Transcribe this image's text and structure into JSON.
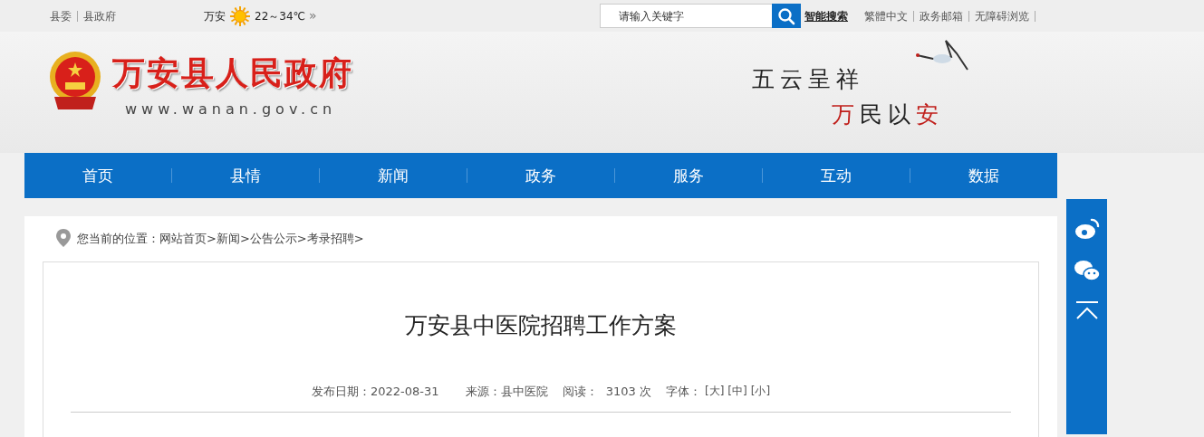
{
  "top_bar": {
    "links": [
      "县委",
      "县政府"
    ],
    "weather": {
      "city": "万安",
      "temperature": "22～34℃",
      "more": "»"
    },
    "search": {
      "placeholder": "请输入关键字"
    },
    "smart_search": "智能搜索",
    "right_links": [
      "繁體中文",
      "政务邮箱",
      "无障碍浏览"
    ]
  },
  "header": {
    "site_title": "万安县人民政府",
    "site_url": "www.wanan.gov.cn",
    "slogan_line_1": "五云呈祥",
    "slogan_line_2": [
      {
        "char": "万",
        "color": "#c0201c"
      },
      {
        "char": "民",
        "color": "#222222"
      },
      {
        "char": "以",
        "color": "#222222"
      },
      {
        "char": "安",
        "color": "#c0201c"
      }
    ]
  },
  "nav": [
    "首页",
    "县情",
    "新闻",
    "政务",
    "服务",
    "互动",
    "数据"
  ],
  "breadcrumb": {
    "label": "您当前的位置：",
    "separator": ">",
    "items": [
      "网站首页",
      "新闻",
      "公告公示",
      "考录招聘"
    ]
  },
  "article": {
    "title": "万安县中医院招聘工作方案",
    "date": "发布日期：2022-08-31",
    "source": "来源：县中医院",
    "views": "阅读：  3103 次",
    "font_label": "字体：",
    "font_sizes": [
      "[大]",
      "[中]",
      "[小]"
    ]
  }
}
